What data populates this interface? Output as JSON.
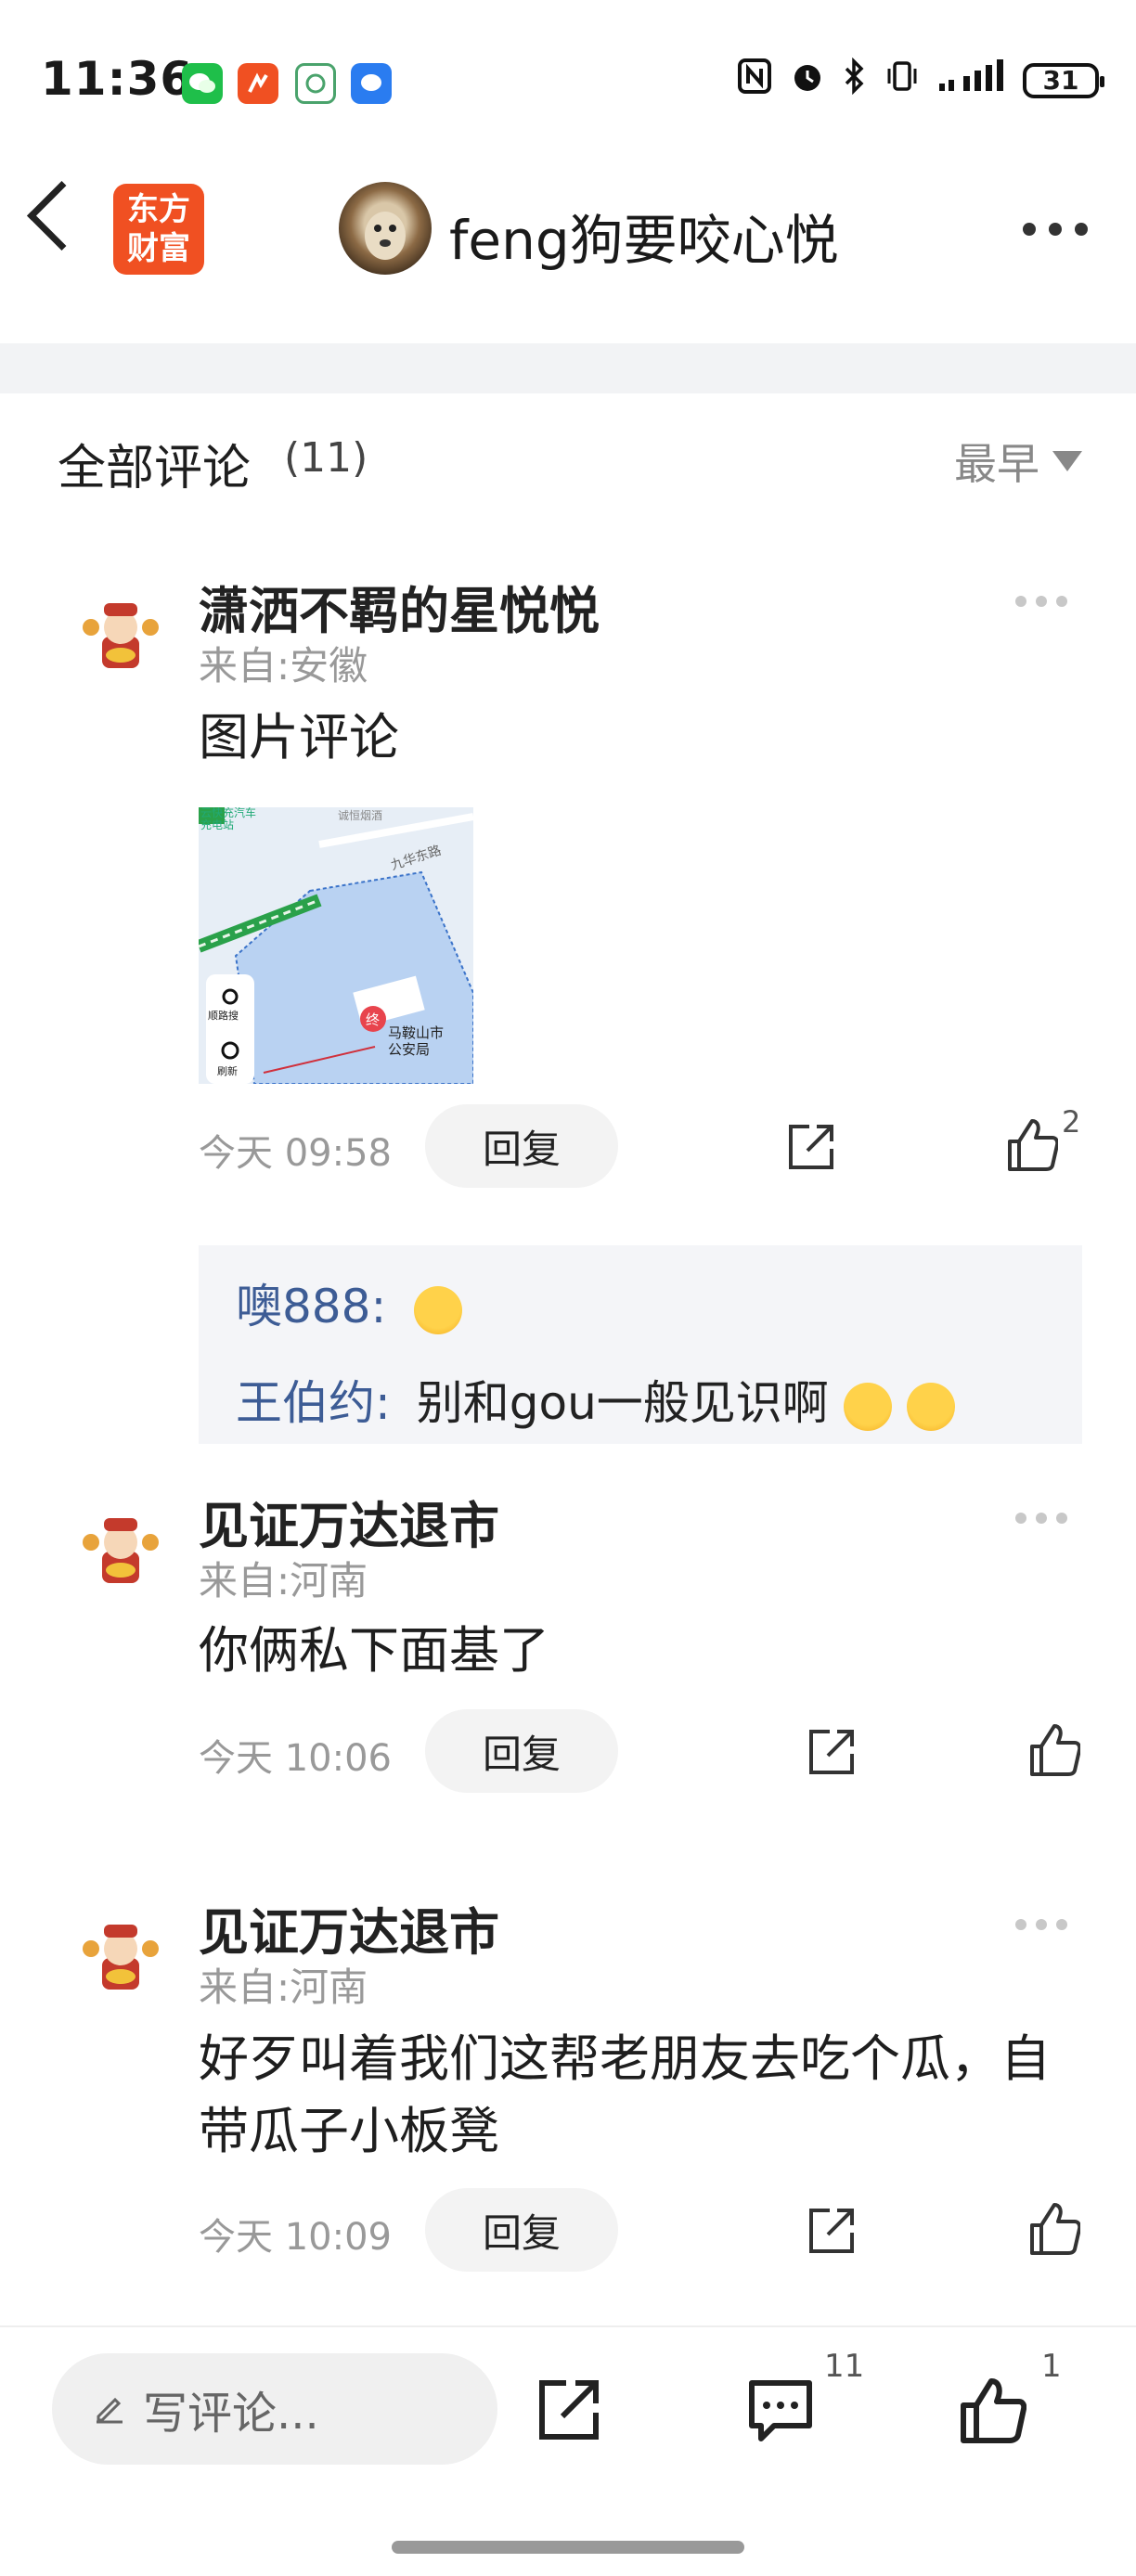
{
  "status_bar": {
    "time": "11:36",
    "battery": "31"
  },
  "header": {
    "brand_line1": "东方",
    "brand_line2": "财富",
    "title": "feng狗要咬心悦"
  },
  "comments_header": {
    "title": "全部评论",
    "count": "(11)",
    "sort": "最早"
  },
  "comments": [
    {
      "user": "潇洒不羁的星悦悦",
      "location": "来自:安徽",
      "text": "图片评论",
      "time": "今天 09:58",
      "reply_label": "回复",
      "likes": "2",
      "image": {
        "labels": [
          "云快充汽车充电站",
          "诚恒烟酒",
          "九华东路",
          "马鞍山市公安局"
        ],
        "side_buttons": [
          "顺路搜",
          "刷新"
        ],
        "marker": "终"
      },
      "sub_replies": [
        {
          "name": "噢888",
          "sep": ":",
          "text": ""
        },
        {
          "name": "王伯约",
          "sep": ":",
          "text": "别和gou一般见识啊"
        }
      ]
    },
    {
      "user": "见证万达退市",
      "location": "来自:河南",
      "text": "你俩私下面基了",
      "time": "今天 10:06",
      "reply_label": "回复",
      "likes": ""
    },
    {
      "user": "见证万达退市",
      "location": "来自:河南",
      "text": "好歹叫着我们这帮老朋友去吃个瓜，自带瓜子小板凳",
      "time": "今天 10:09",
      "reply_label": "回复",
      "likes": ""
    }
  ],
  "bottom_bar": {
    "write_placeholder": "写评论...",
    "comment_count": "11",
    "like_count": "1"
  },
  "colors": {
    "brand": "#f05022",
    "sub_name": "#3d5c95",
    "band": "#f2f3f5"
  }
}
